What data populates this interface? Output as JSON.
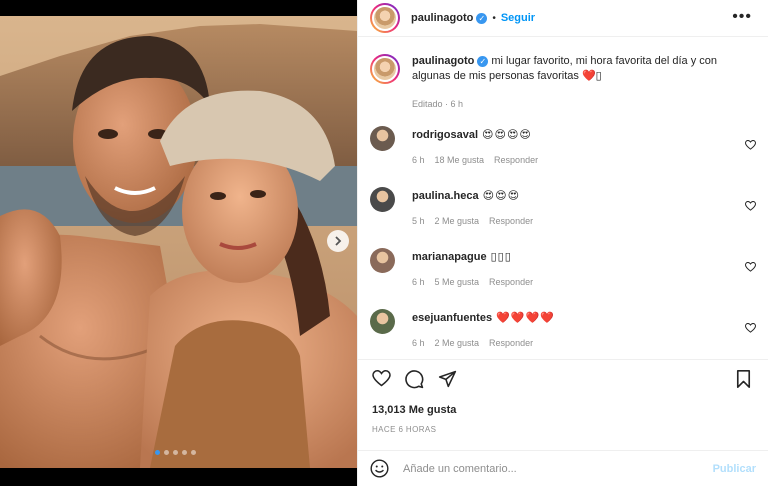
{
  "post": {
    "author": "paulinagoto",
    "follow_label": "Seguir",
    "separator": "•",
    "more_icon": "•••",
    "caption": "mi lugar favorito, mi hora favorita del día y con algunas de mis personas favoritas ❤️▯",
    "caption_meta": "Editado · 6 h",
    "likes": "13,013 Me gusta",
    "time_ago": "HACE 6 HORAS",
    "comment_placeholder": "Añade un comentario...",
    "publish_label": "Publicar"
  },
  "comments": [
    {
      "user": "rodrigosaval",
      "text": "😍😍😍😍",
      "time": "6 h",
      "likes": "18 Me gusta",
      "reply": "Responder"
    },
    {
      "user": "paulina.heca",
      "text": "😍😍😍",
      "time": "5 h",
      "likes": "2 Me gusta",
      "reply": "Responder"
    },
    {
      "user": "marianapague",
      "text": "▯▯▯",
      "time": "6 h",
      "likes": "5 Me gusta",
      "reply": "Responder"
    },
    {
      "user": "esejuanfuentes",
      "text": "❤️❤️❤️❤️",
      "time": "6 h",
      "likes": "2 Me gusta",
      "reply": "Responder"
    }
  ],
  "carousel": {
    "total_slides": 5,
    "active_slide": 1
  },
  "colors": {
    "accent": "#0095f6",
    "verified": "#3897f0",
    "publish_disabled": "#b2dffc",
    "muted": "#8e8e8e"
  },
  "icons": [
    "verified-badge-icon",
    "more-options-icon",
    "heart-icon",
    "comment-icon",
    "share-icon",
    "save-icon",
    "emoji-icon",
    "chevron-right-icon"
  ]
}
